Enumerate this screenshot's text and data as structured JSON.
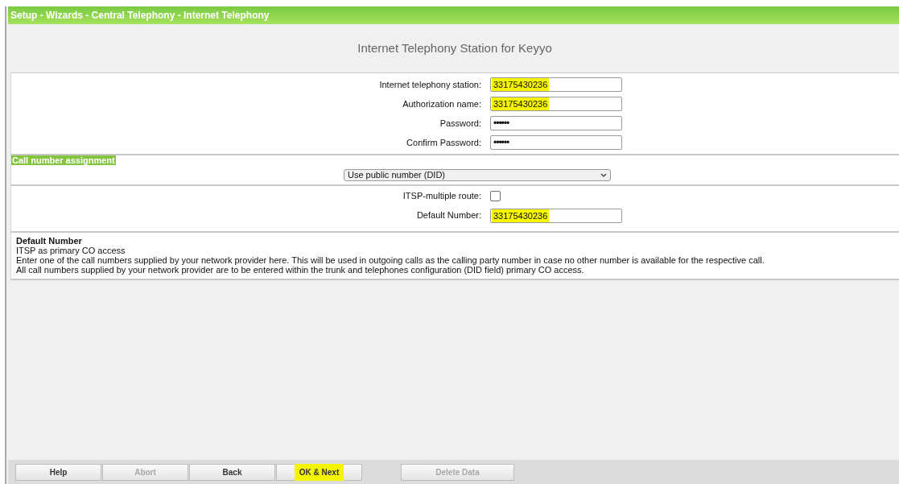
{
  "header": {
    "breadcrumb": "Setup - Wizards - Central Telephony - Internet Telephony"
  },
  "page_title": "Internet Telephony Station for Keyyo",
  "account_fields": [
    {
      "label": "Internet telephony station:",
      "value": "33175430236",
      "kind": "text",
      "highlighted": true
    },
    {
      "label": "Authorization name:",
      "value": "33175430236",
      "kind": "text",
      "highlighted": true
    },
    {
      "label": "Password:",
      "value": "••••••",
      "kind": "password",
      "highlighted": false
    },
    {
      "label": "Confirm Password:",
      "value": "••••••",
      "kind": "password",
      "highlighted": false
    }
  ],
  "call_number_assignment": {
    "heading": "Call number assignment",
    "select": "Use public number (DID)"
  },
  "route_fields": [
    {
      "label": "ITSP-multiple route:",
      "kind": "checkbox",
      "checked": false
    },
    {
      "label": "Default Number:",
      "kind": "text",
      "value": "33175430236",
      "highlighted": true
    }
  ],
  "help": {
    "title": "Default Number",
    "lines": [
      "ITSP as primary CO access",
      "Enter one of the call numbers supplied by your network provider here. This will be used in outgoing calls as the calling party number in case no other number is available for the respective call.",
      "All call numbers supplied by your network provider are to be entered within the trunk and telephones configuration (DID field) primary CO access."
    ]
  },
  "buttons": [
    {
      "label": "Help",
      "disabled": false,
      "highlighted": false
    },
    {
      "label": "Abort",
      "disabled": true,
      "highlighted": false
    },
    {
      "label": "Back",
      "disabled": false,
      "highlighted": false
    },
    {
      "label": "OK & Next",
      "disabled": false,
      "highlighted": true
    },
    {
      "label": "Delete Data",
      "disabled": true,
      "highlighted": false
    }
  ]
}
